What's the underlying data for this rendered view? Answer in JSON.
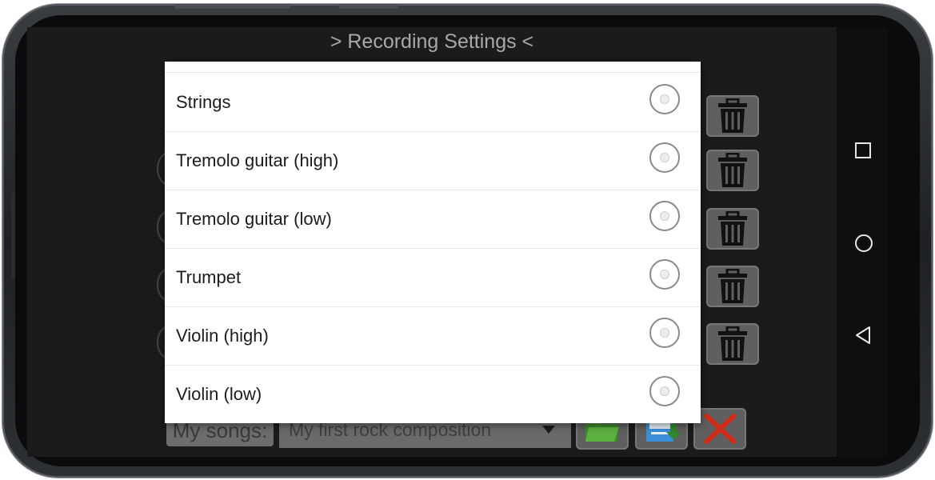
{
  "app": {
    "title": "> Recording Settings <"
  },
  "dialog": {
    "options": [
      {
        "label": "Strings",
        "selected": false
      },
      {
        "label": "Tremolo guitar (high)",
        "selected": false
      },
      {
        "label": "Tremolo guitar (low)",
        "selected": false
      },
      {
        "label": "Trumpet",
        "selected": false
      },
      {
        "label": "Violin (high)",
        "selected": false
      },
      {
        "label": "Violin (low)",
        "selected": false
      }
    ]
  },
  "bottom": {
    "songs_label": "My songs:",
    "songs_value": "My first rock composition"
  },
  "icons": {
    "trash": "trash-icon",
    "open": "folder-open-icon",
    "save": "save-icon",
    "close": "close-x-icon",
    "nav_recents": "square-icon",
    "nav_home": "circle-icon",
    "nav_back": "triangle-back-icon"
  },
  "colors": {
    "close_red": "#d42a1a",
    "folder_green": "#5cb040",
    "save_blue": "#3a8fd8"
  }
}
